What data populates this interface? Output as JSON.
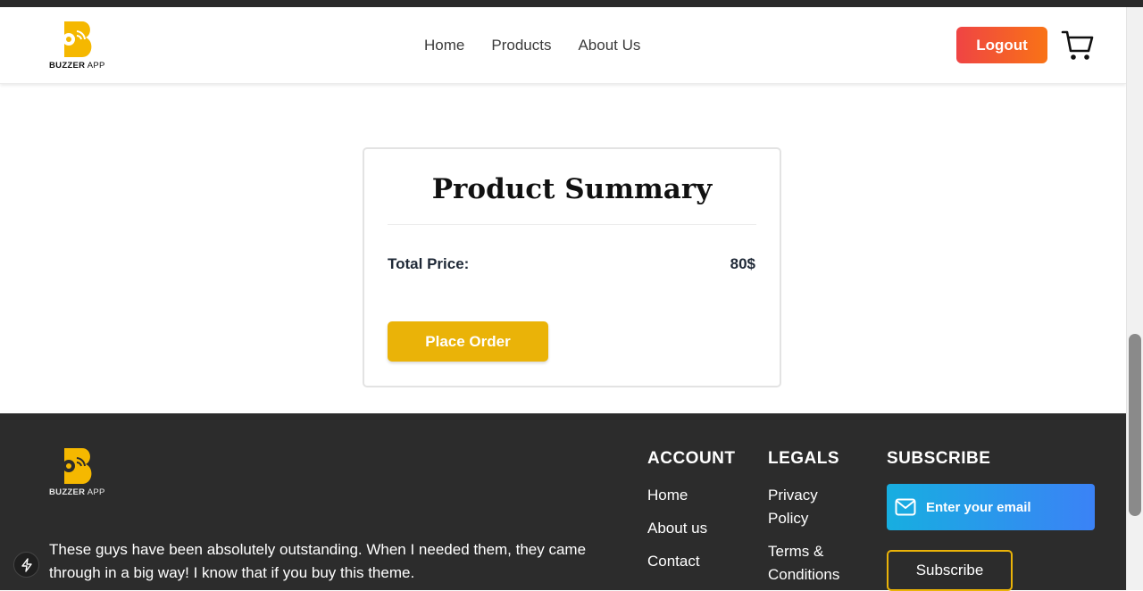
{
  "brand": {
    "name_bold": "BUZZER",
    "name_rest": " APP"
  },
  "nav": {
    "items": [
      "Home",
      "Products",
      "About Us"
    ]
  },
  "header": {
    "logout_label": "Logout",
    "cart_icon": "cart-icon"
  },
  "summary": {
    "title": "Product Summary",
    "total_label": "Total Price:",
    "total_value": "80$",
    "place_order_label": "Place Order"
  },
  "footer": {
    "testimonial": "These guys have been absolutely outstanding. When I needed them, they came through in a big way! I know that if you buy this theme.",
    "account": {
      "heading": "ACCOUNT",
      "links": [
        "Home",
        "About us",
        "Contact"
      ]
    },
    "legals": {
      "heading": "LEGALS",
      "links": [
        "Privacy Policy",
        "Terms & Conditions"
      ]
    },
    "subscribe": {
      "heading": "SUBSCRIBE",
      "email_placeholder": "Enter your email",
      "button_label": "Subscribe"
    }
  },
  "colors": {
    "logout_gradient": [
      "#ef4444",
      "#f97316"
    ],
    "place_order": "#eab308",
    "footer_bg": "#2c2c2c",
    "email_gradient": [
      "#17aee0",
      "#3b82f6"
    ],
    "logo_accent": "#f5b800"
  }
}
